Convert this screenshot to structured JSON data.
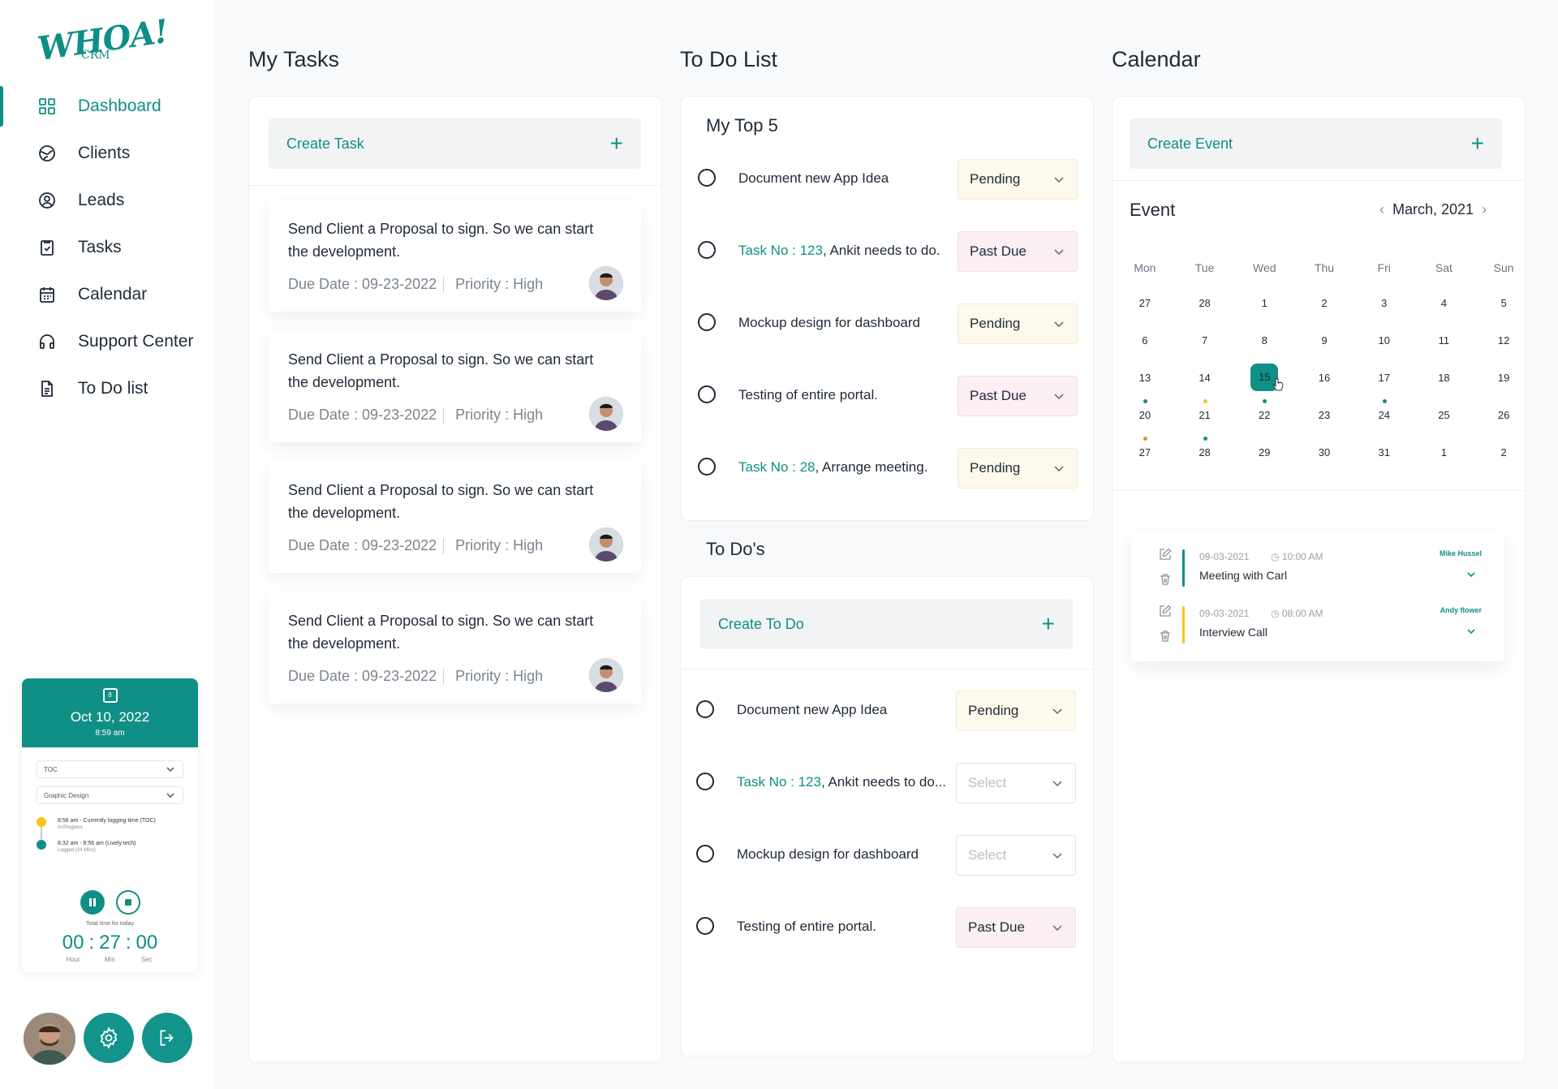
{
  "app": {
    "logo_text": "WHOA!",
    "logo_sub": "CRM"
  },
  "sidebar": {
    "items": [
      {
        "label": "Dashboard",
        "icon": "grid-icon",
        "active": true
      },
      {
        "label": "Clients",
        "icon": "globe-icon"
      },
      {
        "label": "Leads",
        "icon": "user-circle-icon"
      },
      {
        "label": "Tasks",
        "icon": "clipboard-check-icon"
      },
      {
        "label": "Calendar",
        "icon": "calendar-icon"
      },
      {
        "label": "Support Center",
        "icon": "headphones-icon"
      },
      {
        "label": "To Do list",
        "icon": "document-icon"
      }
    ]
  },
  "tracker": {
    "calendar_day": "8",
    "date": "Oct 10, 2022",
    "time": "8:59 am",
    "project_select": "TOC",
    "task_select": "Graphic Design",
    "logs": [
      {
        "text": "8:56 am - Currently logging time (TOC)",
        "sub": "In-Progress",
        "color": "#f5c518"
      },
      {
        "text": "8:32 am - 8:56 am (Lively tech)",
        "sub": "Logged (24 Mins)",
        "color": "#108f86"
      }
    ],
    "total_label": "Total time for today",
    "hours": "00",
    "minutes": "27",
    "seconds": "00",
    "hour_label": "Hour",
    "min_label": "Min",
    "sec_label": "Sec"
  },
  "my_tasks": {
    "title": "My Tasks",
    "create_label": "Create Task",
    "tasks": [
      {
        "title": "Send Client a Proposal to sign. So we can start the development.",
        "due": "Due Date : 09-23-2022",
        "priority": "Priority : High"
      },
      {
        "title": "Send Client a Proposal to sign. So we can start the development.",
        "due": "Due Date : 09-23-2022",
        "priority": "Priority : High"
      },
      {
        "title": "Send Client a Proposal to sign. So we can start the development.",
        "due": "Due Date : 09-23-2022",
        "priority": "Priority : High"
      },
      {
        "title": "Send Client a Proposal to sign. So we can start the development.",
        "due": "Due Date : 09-23-2022",
        "priority": "Priority : High"
      }
    ]
  },
  "todo": {
    "title": "To Do List",
    "top5_title": "My Top 5",
    "top5": [
      {
        "task_no": "",
        "text": "Document new App Idea",
        "status": "Pending"
      },
      {
        "task_no": "Task No : 123",
        "text": ", Ankit needs to do.",
        "status": "Past Due"
      },
      {
        "task_no": "",
        "text": "Mockup design for dashboard",
        "status": "Pending"
      },
      {
        "task_no": "",
        "text": "Testing of entire portal.",
        "status": "Past Due"
      },
      {
        "task_no": "Task No : 28",
        "text": ", Arrange meeting.",
        "status": "Pending"
      }
    ],
    "todos_title": "To Do's",
    "create_label": "Create To Do",
    "todos": [
      {
        "task_no": "",
        "text": "Document new App Idea",
        "status": "Pending"
      },
      {
        "task_no": "Task No : 123",
        "text": ", Ankit needs to do...",
        "status": "Select"
      },
      {
        "task_no": "",
        "text": "Mockup design for dashboard",
        "status": "Select"
      },
      {
        "task_no": "",
        "text": "Testing of entire portal.",
        "status": "Past Due"
      }
    ]
  },
  "calendar": {
    "title": "Calendar",
    "create_label": "Create Event",
    "event_label": "Event",
    "month": "March, 2021",
    "weekdays": [
      "Mon",
      "Tue",
      "Wed",
      "Thu",
      "Fri",
      "Sat",
      "Sun"
    ],
    "weeks": [
      [
        {
          "d": "27",
          "m": true
        },
        {
          "d": "28",
          "m": true
        },
        {
          "d": "1"
        },
        {
          "d": "2"
        },
        {
          "d": "3"
        },
        {
          "d": "4"
        },
        {
          "d": "5"
        }
      ],
      [
        {
          "d": "6"
        },
        {
          "d": "7"
        },
        {
          "d": "8"
        },
        {
          "d": "9"
        },
        {
          "d": "10"
        },
        {
          "d": "11"
        },
        {
          "d": "12"
        }
      ],
      [
        {
          "d": "13"
        },
        {
          "d": "14"
        },
        {
          "d": "15",
          "today": true
        },
        {
          "d": "16"
        },
        {
          "d": "17"
        },
        {
          "d": "18"
        },
        {
          "d": "19"
        }
      ],
      [
        {
          "d": "20",
          "dot": "#108f86"
        },
        {
          "d": "21",
          "dot": "#f5c518"
        },
        {
          "d": "22",
          "dot": "#108f86"
        },
        {
          "d": "23"
        },
        {
          "d": "24",
          "dot": "#108f86"
        },
        {
          "d": "25"
        },
        {
          "d": "26"
        }
      ],
      [
        {
          "d": "27",
          "dot": "#f08a24"
        },
        {
          "d": "28",
          "dot": "#108f86"
        },
        {
          "d": "29"
        },
        {
          "d": "30"
        },
        {
          "d": "31"
        },
        {
          "d": "1",
          "m": true
        },
        {
          "d": "2",
          "m": true
        }
      ]
    ],
    "events": [
      {
        "date": "09-03-2021",
        "time": "10:00 AM",
        "name": "Meeting with Carl",
        "owner": "Mike Hussel",
        "color": "#108f86"
      },
      {
        "date": "09-03-2021",
        "time": "08:00 AM",
        "name": "Interview Call",
        "owner": "Andy flower",
        "color": "#f5c518"
      }
    ]
  },
  "colors": {
    "accent": "#108f86",
    "pending_bg": "#fdf9ec",
    "pastdue_bg": "#fbeff3"
  }
}
